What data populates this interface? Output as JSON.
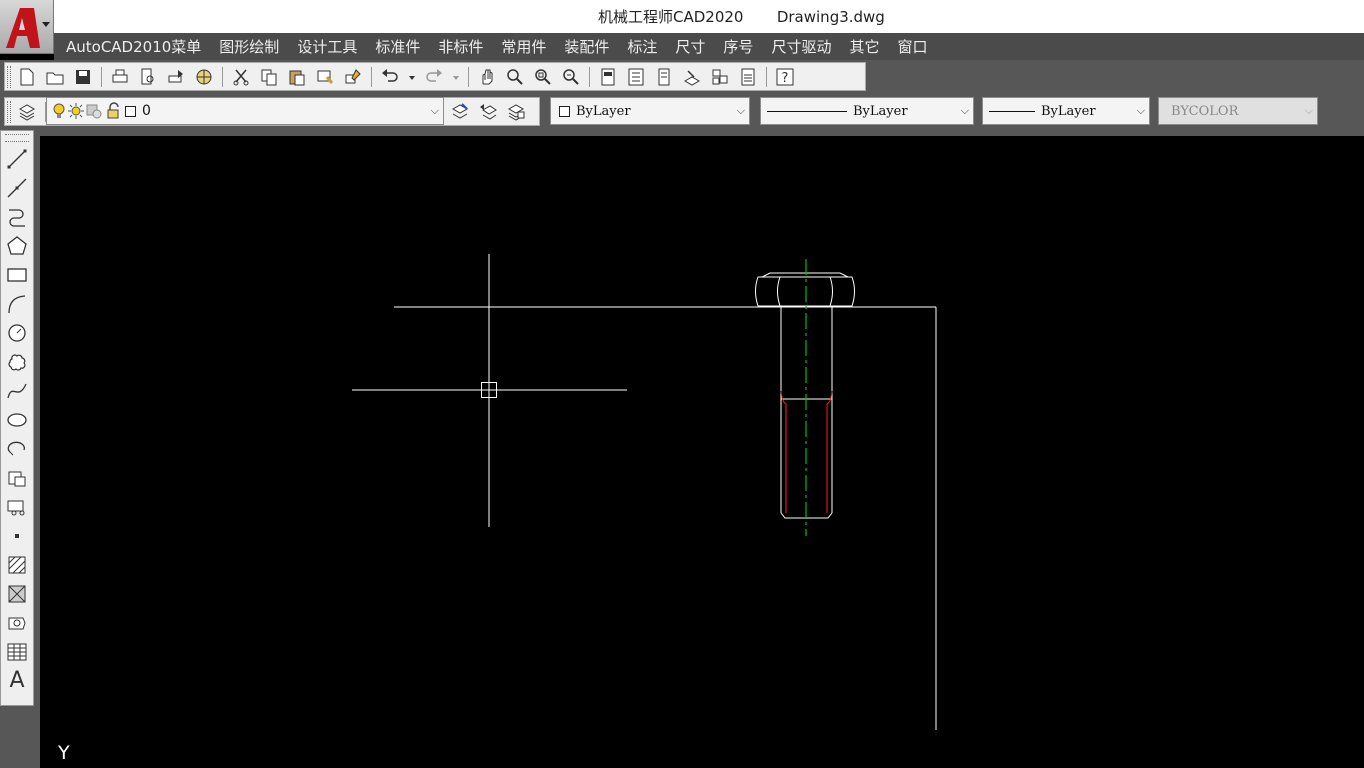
{
  "window": {
    "title": "机械工程师CAD2020       Drawing3.dwg",
    "logo_letter": "A"
  },
  "menu": [
    "AutoCAD2010菜单",
    "图形绘制",
    "设计工具",
    "标准件",
    "非标件",
    "常用件",
    "装配件",
    "标注",
    "尺寸",
    "序号",
    "尺寸驱动",
    "其它",
    "窗口"
  ],
  "standard_toolbar": {
    "icons": [
      "new-icon",
      "open-icon",
      "save-icon",
      "print-icon",
      "print-preview-icon",
      "publish-icon",
      "3d-dwf-icon",
      "cut-icon",
      "copy-icon",
      "paste-icon",
      "match-properties-icon",
      "block-editor-icon",
      "undo-icon",
      "redo-icon",
      "pan-icon",
      "zoom-realtime-icon",
      "zoom-window-icon",
      "zoom-previous-icon",
      "properties-icon",
      "design-center-icon",
      "tool-palettes-icon",
      "markup-icon",
      "sheet-set-icon",
      "calculator-icon",
      "help-icon"
    ]
  },
  "layers_toolbar": {
    "current_layer": "0",
    "icons": [
      "layer-properties-icon",
      "bulb-on-icon",
      "sun-icon",
      "freeze-viewport-icon",
      "lock-icon",
      "layer-previous-icon",
      "layer-state-icon",
      "make-current-icon"
    ]
  },
  "properties_toolbar": {
    "color": "ByLayer",
    "linetype": "ByLayer",
    "lineweight": "ByLayer",
    "plotstyle": "BYCOLOR"
  },
  "draw_toolbar": {
    "icons": [
      "line-icon",
      "construction-line-icon",
      "polyline-icon",
      "polygon-icon",
      "rectangle-icon",
      "arc-icon",
      "circle-icon",
      "revision-cloud-icon",
      "spline-icon",
      "ellipse-icon",
      "ellipse-arc-icon",
      "insert-block-icon",
      "make-block-icon",
      "point-icon",
      "hatch-icon",
      "gradient-icon",
      "region-icon",
      "table-icon",
      "multiline-text-icon"
    ],
    "text_icon_glyph": "A"
  },
  "drawing": {
    "ucs_label": "Y",
    "colors": {
      "background": "#000000",
      "lines": "#ffffff",
      "centerline": "#00c000",
      "thread": "#ff2020"
    }
  }
}
